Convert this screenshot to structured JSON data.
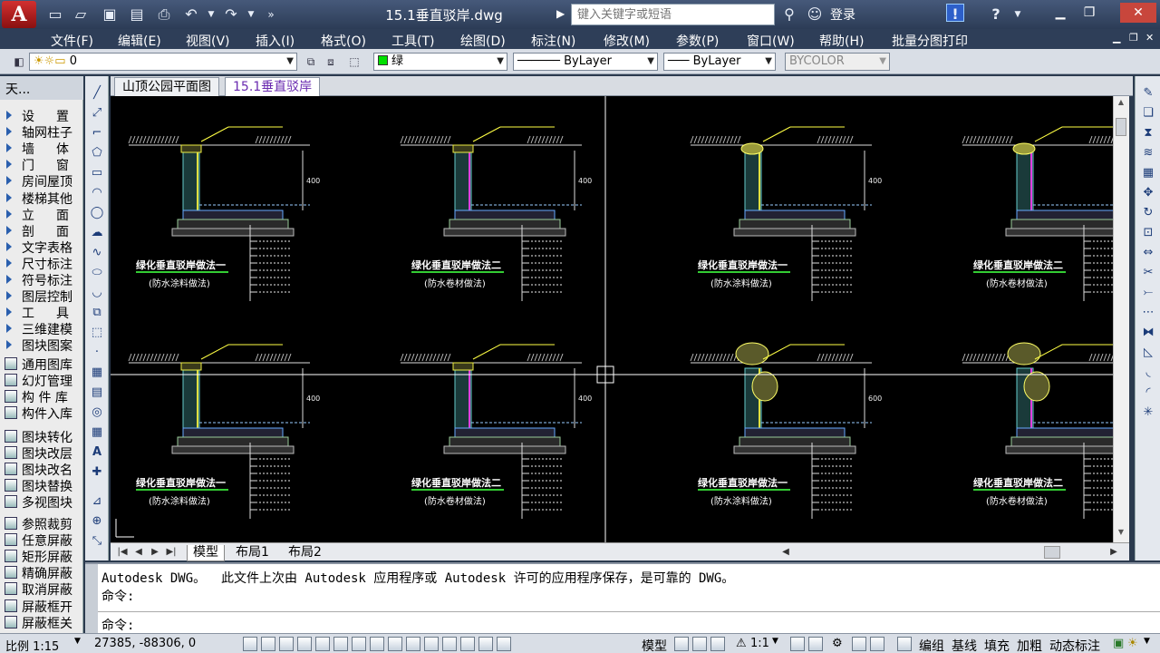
{
  "titlebar": {
    "app_logo": "A",
    "doc_title": "15.1垂直驳岸.dwg",
    "search_placeholder": "键入关键字或短语",
    "login_label": "登录"
  },
  "menu": {
    "items": [
      "文件(F)",
      "编辑(E)",
      "视图(V)",
      "插入(I)",
      "格式(O)",
      "工具(T)",
      "绘图(D)",
      "标注(N)",
      "修改(M)",
      "参数(P)",
      "窗口(W)",
      "帮助(H)",
      "批量分图打印"
    ]
  },
  "layerbar": {
    "layer_value": "0",
    "color_value": "绿",
    "linetype_value": "ByLayer",
    "lineweight_value": "ByLayer",
    "plotstyle_value": "BYCOLOR"
  },
  "palette": {
    "title": "天...",
    "group1": [
      "设置",
      "轴网柱子",
      "墙体",
      "门窗",
      "房间屋顶",
      "楼梯其他",
      "立面",
      "剖面",
      "文字表格",
      "尺寸标注",
      "符号标注",
      "图层控制",
      "工具",
      "三维建模",
      "图块图案"
    ],
    "group2": [
      "通用图库",
      "幻灯管理",
      "构 件 库",
      "构件入库"
    ],
    "group3": [
      "图块转化",
      "图块改层",
      "图块改名",
      "图块替换",
      "多视图块"
    ],
    "group4": [
      "参照裁剪",
      "任意屏蔽",
      "矩形屏蔽",
      "精确屏蔽",
      "取消屏蔽",
      "屏蔽框开",
      "屏蔽框关"
    ]
  },
  "file_tabs": [
    "山顶公园平面图",
    "15.1垂直驳岸"
  ],
  "layout_tabs": [
    "模型",
    "布局1",
    "布局2"
  ],
  "drawing": {
    "titles": [
      "绿化垂直驳岸做法一",
      "绿化垂直驳岸做法二",
      "绿化垂直驳岸做法一",
      "绿化垂直驳岸做法二",
      "绿化垂直驳岸做法一",
      "绿化垂直驳岸做法二",
      "绿化垂直驳岸做法一",
      "绿化垂直驳岸做法二"
    ],
    "subtitles": [
      "(防水涂料做法)",
      "(防水卷材做法)",
      "(防水涂料做法)",
      "(防水卷材做法)",
      "(防水涂料做法)",
      "(防水卷材做法)",
      "(防水涂料做法)",
      "(防水卷材做法)"
    ],
    "dim_400": "400",
    "dim_600": "600"
  },
  "command": {
    "line1": "Autodesk DWG。  此文件上次由 Autodesk 应用程序或 Autodesk 许可的应用程序保存，是可靠的 DWG。",
    "line2": "命令:",
    "prompt": "命令:"
  },
  "status": {
    "scale": "比例 1:15",
    "coords": "27385, -88306, 0",
    "model_label": "模型",
    "annot_scale": "1:1",
    "buttons": [
      "编组",
      "基线",
      "填充",
      "加粗",
      "动态标注"
    ]
  }
}
